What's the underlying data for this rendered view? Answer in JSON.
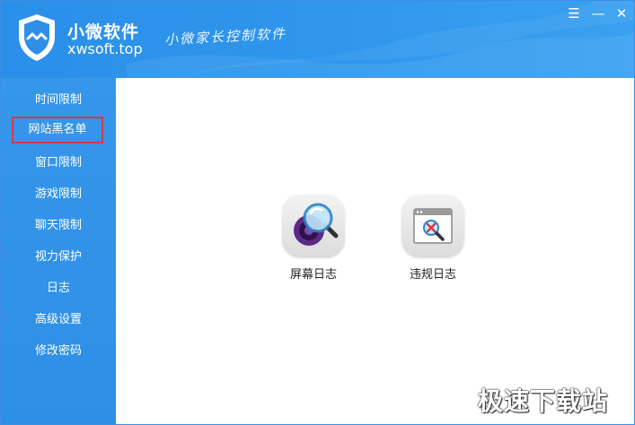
{
  "header": {
    "brand_name": "小微软件",
    "brand_domain": "xwsoft.top",
    "slogan": "小微家长控制软件",
    "menu_icon": "hamburger-icon",
    "minimize_icon": "minimize-icon",
    "close_icon": "close-icon",
    "menu_glyph": "☰",
    "minimize_glyph": "—",
    "close_glyph": "✕"
  },
  "sidebar": {
    "active_index": 1,
    "items": [
      {
        "label": "时间限制"
      },
      {
        "label": "网站黑名单"
      },
      {
        "label": "窗口限制"
      },
      {
        "label": "游戏限制"
      },
      {
        "label": "聊天限制"
      },
      {
        "label": "视力保护"
      },
      {
        "label": "日志"
      },
      {
        "label": "高级设置"
      },
      {
        "label": "修改密码"
      }
    ]
  },
  "main": {
    "tiles": [
      {
        "label": "屏幕日志",
        "icon": "magnifier-icon"
      },
      {
        "label": "违规日志",
        "icon": "violation-window-icon"
      }
    ]
  },
  "watermark": "极速下载站",
  "colors": {
    "header_blue": "#2f96ec",
    "sidebar_blue": "#3596ea",
    "active_border": "#d9364e"
  }
}
